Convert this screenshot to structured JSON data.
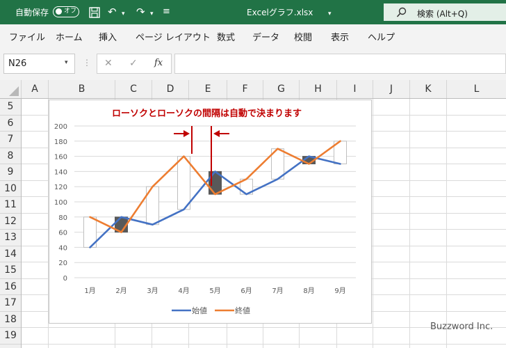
{
  "titlebar": {
    "autosave_label": "自動保存",
    "autosave_state": "オフ",
    "filename": "Excelグラフ.xlsx",
    "search_label": "検索 (Alt+Q)",
    "bg_color": "#217346"
  },
  "menu": [
    "ファイル",
    "ホーム",
    "挿入",
    "ページ レイアウト",
    "数式",
    "データ",
    "校閲",
    "表示",
    "ヘルプ"
  ],
  "formula": {
    "name_box": "N26",
    "fx": "fx",
    "value": ""
  },
  "columns": [
    "A",
    "B",
    "C",
    "D",
    "E",
    "F",
    "G",
    "H",
    "I",
    "J",
    "K",
    "L"
  ],
  "rows": [
    "5",
    "6",
    "7",
    "8",
    "9",
    "10",
    "11",
    "12",
    "13",
    "14",
    "15",
    "16",
    "17",
    "18",
    "19"
  ],
  "annotation": "ローソクとローソクの間隔は自動で決まります",
  "watermark": "Buzzword Inc.",
  "chart_data": {
    "type": "line",
    "categories": [
      "1月",
      "2月",
      "3月",
      "4月",
      "5月",
      "6月",
      "7月",
      "8月",
      "9月"
    ],
    "series": [
      {
        "name": "始値",
        "values": [
          40,
          80,
          70,
          90,
          140,
          110,
          130,
          160,
          150
        ],
        "color": "#4472c4"
      },
      {
        "name": "終値",
        "values": [
          80,
          60,
          120,
          160,
          110,
          130,
          170,
          150,
          180
        ],
        "color": "#ed7d31"
      }
    ],
    "ylim": [
      0,
      200
    ],
    "yticks": [
      0,
      20,
      40,
      60,
      80,
      100,
      120,
      140,
      160,
      180,
      200
    ],
    "grid": true,
    "legend": "bottom",
    "candle_up_color": "#ffffff",
    "candle_down_color": "#595959",
    "annotation_color": "#c00000"
  }
}
